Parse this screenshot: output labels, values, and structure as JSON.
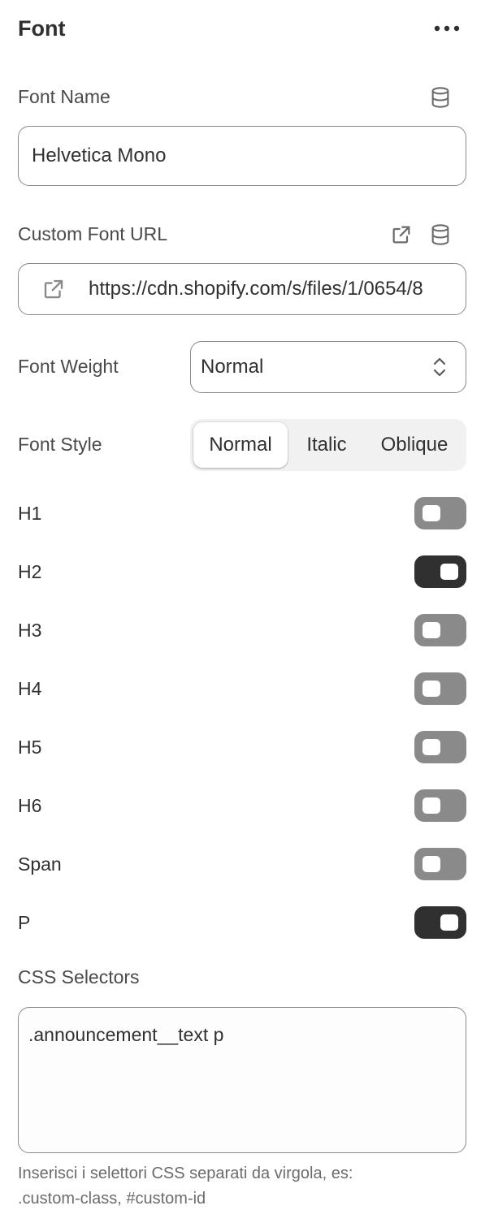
{
  "header": {
    "title": "Font",
    "more_icon": "more-horizontal-icon"
  },
  "font_name": {
    "label": "Font Name",
    "value": "Helvetica Mono",
    "icon": "database-icon"
  },
  "custom_font_url": {
    "label": "Custom Font URL",
    "value": "https://cdn.shopify.com/s/files/1/0654/8",
    "icons": [
      "external-link-icon",
      "database-icon"
    ]
  },
  "font_weight": {
    "label": "Font Weight",
    "selected": "Normal"
  },
  "font_style": {
    "label": "Font Style",
    "options": [
      "Normal",
      "Italic",
      "Oblique"
    ],
    "selected": "Normal"
  },
  "toggles": [
    {
      "label": "H1",
      "on": false
    },
    {
      "label": "H2",
      "on": true
    },
    {
      "label": "H3",
      "on": false
    },
    {
      "label": "H4",
      "on": false
    },
    {
      "label": "H5",
      "on": false
    },
    {
      "label": "H6",
      "on": false
    },
    {
      "label": "Span",
      "on": false
    },
    {
      "label": "P",
      "on": true
    }
  ],
  "css_selectors": {
    "label": "CSS Selectors",
    "value": ".announcement__text p",
    "help_line1": "Inserisci i selettori CSS separati da virgola, es:",
    "help_line2": ".custom-class, #custom-id"
  },
  "colors": {
    "text": "#303030",
    "toggle_on": "#303030",
    "toggle_off": "#8a8a8a",
    "border": "#8a8a8a"
  }
}
